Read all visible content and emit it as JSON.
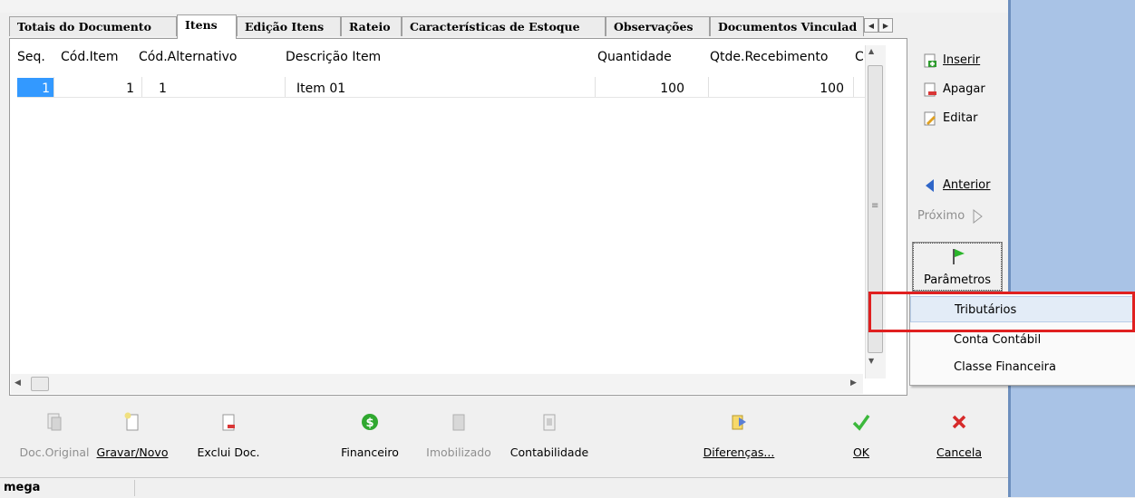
{
  "tabs": [
    {
      "label": "Totais do Documento",
      "active": false
    },
    {
      "label": "Itens",
      "active": true
    },
    {
      "label": "Edição Itens",
      "active": false
    },
    {
      "label": "Rateio",
      "active": false
    },
    {
      "label": "Características de Estoque",
      "active": false
    },
    {
      "label": "Observações",
      "active": false
    },
    {
      "label": "Documentos Vinculad",
      "active": false
    }
  ],
  "grid": {
    "columns": [
      "Seq.",
      "Cód.Item",
      "Cód.Alternativo",
      "Descrição Item",
      "Quantidade",
      "Qtde.Recebimento",
      "Cu"
    ],
    "rows": [
      [
        "1",
        "1",
        "1",
        "Item 01",
        "100",
        "100",
        ""
      ]
    ]
  },
  "side": {
    "inserir": "Inserir",
    "apagar": "Apagar",
    "editar": "Editar",
    "anterior": "Anterior",
    "proximo": "Próximo",
    "parametros": "Parâmetros"
  },
  "menu": {
    "items": [
      "Tributários",
      "Conta Contábil",
      "Classe Financeira"
    ],
    "highlighted": "Tributários"
  },
  "toolbar": {
    "doc_original": "Doc.Original",
    "gravar_novo": "Gravar/Novo",
    "exclui_doc": "Exclui Doc.",
    "financeiro": "Financeiro",
    "imobilizado": "Imobilizado",
    "contabilidade": "Contabilidade",
    "diferencas": "Diferenças...",
    "ok": "OK",
    "cancela": "Cancela"
  },
  "status": {
    "user": "mega"
  },
  "colors": {
    "accent_blue": "#3399ff",
    "highlight_red": "#e02020",
    "panel_blue": "#a9c3e6"
  }
}
